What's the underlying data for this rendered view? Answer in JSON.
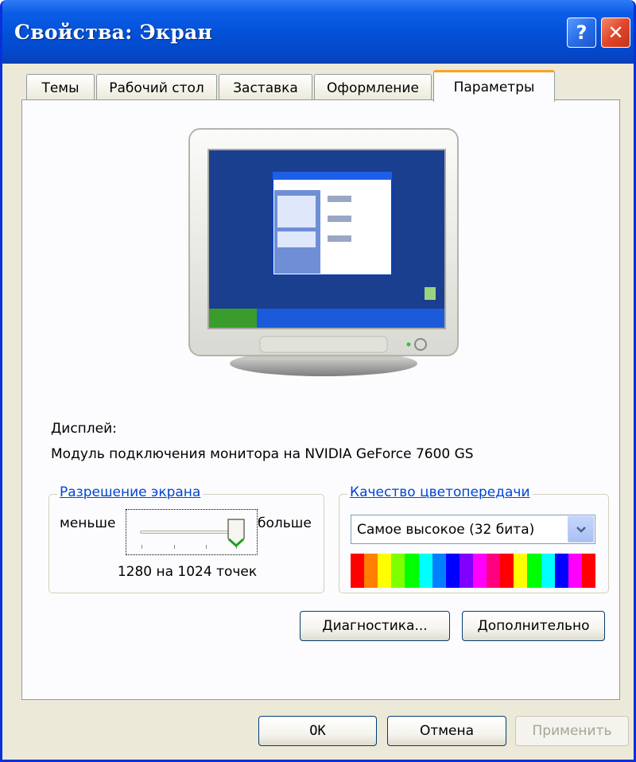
{
  "window": {
    "title": "Свойства: Экран",
    "help_glyph": "?",
    "close_glyph": "✕"
  },
  "tabs": [
    {
      "label": "Темы"
    },
    {
      "label": "Рабочий стол"
    },
    {
      "label": "Заставка"
    },
    {
      "label": "Оформление"
    },
    {
      "label": "Параметры",
      "active": true
    }
  ],
  "display": {
    "label": "Дисплей:",
    "name": "Модуль подключения монитора на NVIDIA GeForce 7600 GS"
  },
  "resolution": {
    "group_label": "Разрешение экрана",
    "less_label": "меньше",
    "more_label": "больше",
    "value_text": "1280 на 1024 точек"
  },
  "color_quality": {
    "group_label": "Качество цветопередачи",
    "selected": "Самое высокое (32 бита)",
    "spectrum_colors": [
      "#ff0000",
      "#ff7f00",
      "#ffff00",
      "#7fff00",
      "#00ff00",
      "#00ffff",
      "#0080ff",
      "#0000ff",
      "#8000ff",
      "#ff00ff",
      "#ff0080",
      "#ff0000",
      "#ffff00",
      "#00ff00",
      "#00ffff",
      "#0000ff",
      "#ff00ff",
      "#ff0000"
    ]
  },
  "buttons": {
    "diagnostics": "Диагностика...",
    "advanced": "Дополнительно",
    "ok": "OK",
    "cancel": "Отмена",
    "apply": "Применить"
  },
  "colors": {
    "title_bar": "#0350d6",
    "accent_text": "#0046d5",
    "active_tab": "#f5a623",
    "face": "#ece9d8"
  }
}
